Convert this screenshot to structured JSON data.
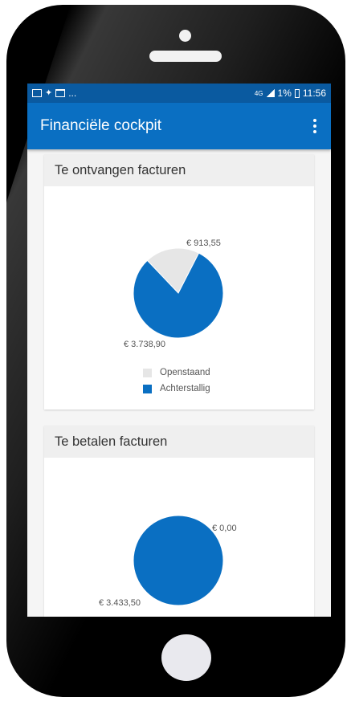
{
  "statusbar": {
    "left_icons": [
      "image-icon",
      "twitter-icon",
      "book-icon"
    ],
    "ellipsis": "...",
    "network": "4G",
    "battery": "1%",
    "time": "11:56"
  },
  "appbar": {
    "title": "Financiële cockpit",
    "menu_icon": "more-vertical-icon"
  },
  "colors": {
    "statusbar": "#0a5aa0",
    "appbar": "#0a6fc2",
    "blue": "#0a6fc2",
    "grey": "#e6e6e6"
  },
  "cards": [
    {
      "title": "Te ontvangen facturen",
      "chart_data": {
        "type": "pie",
        "slices": [
          {
            "label": "Openstaand",
            "value": 913.55,
            "text": "€ 913,55",
            "color": "#e6e6e6"
          },
          {
            "label": "Achterstallig",
            "value": 3738.9,
            "text": "€ 3.738,90",
            "color": "#0a6fc2"
          }
        ],
        "legend": [
          "Openstaand",
          "Achterstallig"
        ]
      }
    },
    {
      "title": "Te betalen facturen",
      "chart_data": {
        "type": "pie",
        "slices": [
          {
            "label": "Openstaand",
            "value": 0,
            "text": "€ 0,00",
            "color": "#e6e6e6"
          },
          {
            "label": "Achterstallig",
            "value": 3433.5,
            "text": "€ 3.433,50",
            "color": "#0a6fc2"
          }
        ]
      }
    }
  ]
}
